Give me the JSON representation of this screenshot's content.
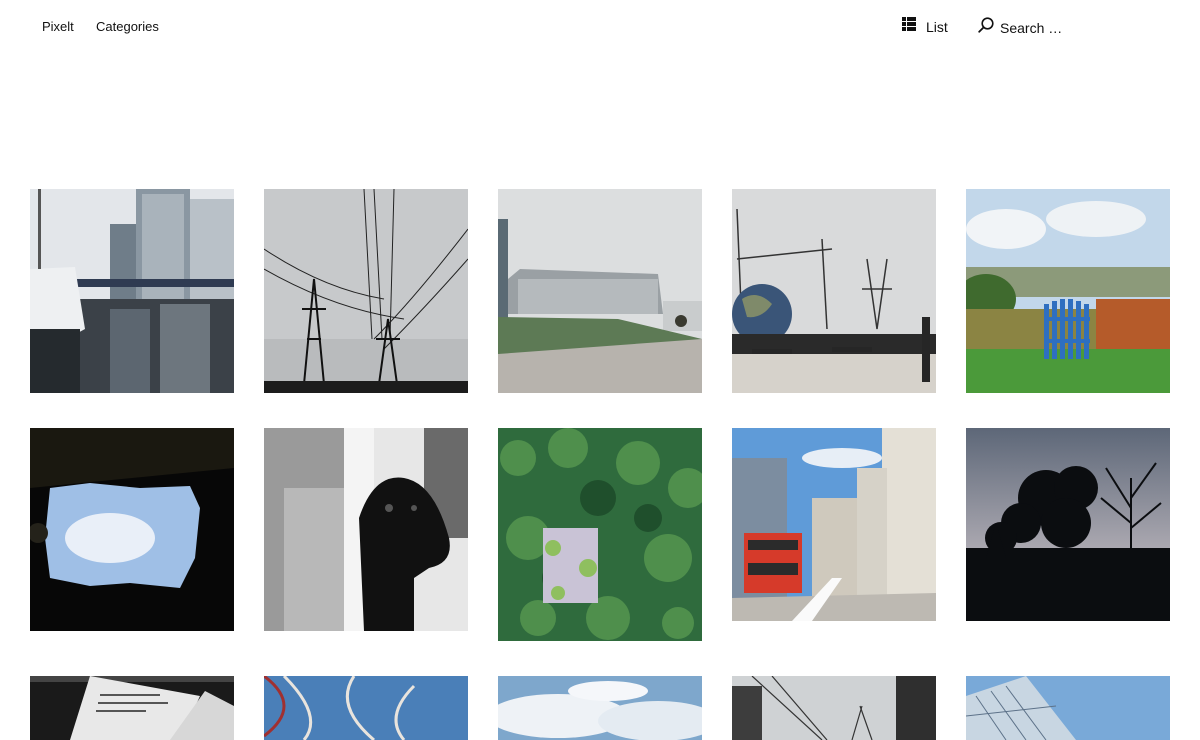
{
  "nav": {
    "site_title": "Pixelt",
    "categories_label": "Categories",
    "view_label": "List",
    "search_placeholder": "Search …"
  },
  "icons": {
    "view_toggle": "list-grid-icon",
    "search": "search-icon"
  },
  "photos": [
    {
      "subject": "harbor-with-yacht-and-office-towers"
    },
    {
      "subject": "power-lines-and-pylons-grey-sky"
    },
    {
      "subject": "industrial-building-with-green-bank"
    },
    {
      "subject": "rooftop-terrace-with-globe-and-pylons"
    },
    {
      "subject": "countryside-with-blue-gate"
    },
    {
      "subject": "looking-up-through-dark-opening-to-sky"
    },
    {
      "subject": "black-and-white-dog-peeking"
    },
    {
      "subject": "ivy-covered-wall-with-window"
    },
    {
      "subject": "city-street-with-red-double-decker-bus"
    },
    {
      "subject": "tree-silhouette-at-dusk"
    },
    {
      "subject": "newspaper-held-up"
    },
    {
      "subject": "netting-against-blue-sky"
    },
    {
      "subject": "clouds-in-blue-sky"
    },
    {
      "subject": "bridge-cables-and-building"
    },
    {
      "subject": "glass-skyscraper-against-sky"
    }
  ]
}
